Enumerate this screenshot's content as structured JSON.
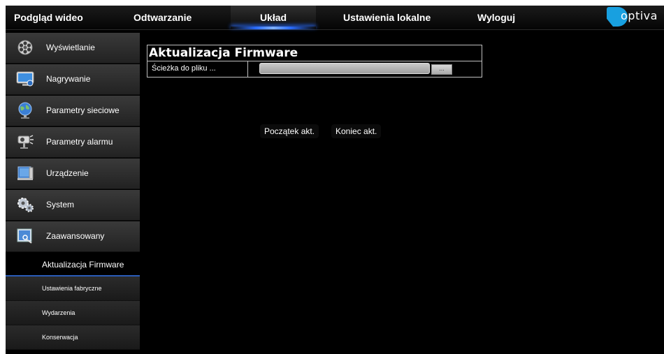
{
  "nav": {
    "items": [
      {
        "label": "Podgląd wideo",
        "active": false
      },
      {
        "label": "Odtwarzanie",
        "active": false
      },
      {
        "label": "Układ",
        "active": true
      },
      {
        "label": "Ustawienia lokalne",
        "active": false
      },
      {
        "label": "Wyloguj",
        "active": false
      }
    ],
    "logo_text": "optiva",
    "accent_color": "#2a6cff"
  },
  "sidebar": {
    "items": [
      {
        "label": "Wyświetlanie",
        "icon": "film-reel-icon"
      },
      {
        "label": "Nagrywanie",
        "icon": "monitor-record-icon"
      },
      {
        "label": "Parametry sieciowe",
        "icon": "globe-network-icon"
      },
      {
        "label": "Parametry alarmu",
        "icon": "alarm-camera-icon"
      },
      {
        "label": "Urządzenie",
        "icon": "device-icon"
      },
      {
        "label": "System",
        "icon": "gears-icon"
      },
      {
        "label": "Zaawansowany",
        "icon": "advanced-settings-icon"
      }
    ],
    "subitems": [
      {
        "label": "Aktualizacja Firmware",
        "active": true
      },
      {
        "label": "Ustawienia fabryczne",
        "active": false
      },
      {
        "label": "Wydarzenia",
        "active": false
      },
      {
        "label": "Konserwacja",
        "active": false
      }
    ]
  },
  "main": {
    "title": "Aktualizacja Firmware",
    "path_label": "Ścieżka do pliku ...",
    "path_value": "",
    "browse_label": "...",
    "start_button": "Początek akt.",
    "end_button": "Koniec akt."
  }
}
